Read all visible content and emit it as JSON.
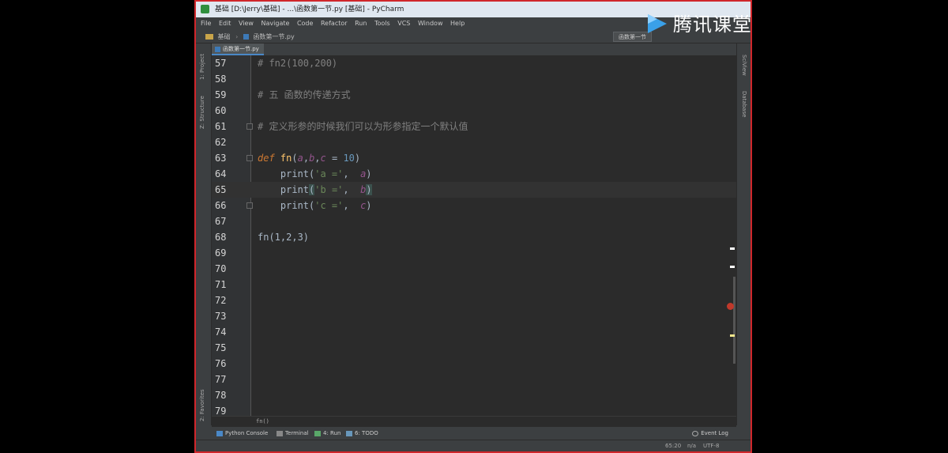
{
  "window": {
    "title": "基础 [D:\\Jerry\\基础] - ...\\函数第一节.py [基础] - PyCharm"
  },
  "menu": [
    "File",
    "Edit",
    "View",
    "Navigate",
    "Code",
    "Refactor",
    "Run",
    "Tools",
    "VCS",
    "Window",
    "Help"
  ],
  "nav": {
    "project": "基础",
    "file": "函数第一节.py",
    "run_config": "函数第一节"
  },
  "tab": {
    "label": "函数第一节.py"
  },
  "left_tools": [
    "1: Project",
    "Z: Structure",
    "2: Favorites"
  ],
  "right_tools": [
    "SciView",
    "Database"
  ],
  "editor": {
    "lines": [
      {
        "n": "57",
        "parts": [
          [
            "comment",
            "# fn2(100,200)"
          ]
        ]
      },
      {
        "n": "58",
        "parts": []
      },
      {
        "n": "59",
        "parts": [
          [
            "comment",
            "# 五 函数的传递方式"
          ]
        ]
      },
      {
        "n": "60",
        "parts": []
      },
      {
        "n": "61",
        "parts": [
          [
            "comment",
            "# 定义形参的时候我们可以为形参指定一个默认值"
          ]
        ]
      },
      {
        "n": "62",
        "parts": []
      },
      {
        "n": "63",
        "parts": [
          [
            "kw",
            "def "
          ],
          [
            "fnname",
            "fn"
          ],
          [
            "p",
            "("
          ],
          [
            "param",
            "a"
          ],
          [
            "p",
            ","
          ],
          [
            "param",
            "b"
          ],
          [
            "p",
            ","
          ],
          [
            "param",
            "c"
          ],
          [
            "p",
            " = "
          ],
          [
            "num",
            "10"
          ],
          [
            "p",
            ")"
          ]
        ]
      },
      {
        "n": "64",
        "parts": [
          [
            "p",
            "    print("
          ],
          [
            "str",
            "'a ='"
          ],
          [
            "p",
            ",  "
          ],
          [
            "param",
            "a"
          ],
          [
            "p",
            ")"
          ]
        ]
      },
      {
        "n": "65",
        "parts": [
          [
            "p",
            "    print"
          ],
          [
            "hl",
            "("
          ],
          [
            "str",
            "'b ='"
          ],
          [
            "p",
            ",  "
          ],
          [
            "param",
            "b"
          ],
          [
            "hl",
            ")"
          ]
        ]
      },
      {
        "n": "66",
        "parts": [
          [
            "p",
            "    print("
          ],
          [
            "str",
            "'c ='"
          ],
          [
            "p",
            ",  "
          ],
          [
            "param",
            "c"
          ],
          [
            "p",
            ")"
          ]
        ]
      },
      {
        "n": "67",
        "parts": []
      },
      {
        "n": "68",
        "parts": [
          [
            "p",
            "fn(1,2,3)"
          ]
        ]
      },
      {
        "n": "69",
        "parts": []
      },
      {
        "n": "70",
        "parts": []
      },
      {
        "n": "71",
        "parts": []
      },
      {
        "n": "72",
        "parts": []
      },
      {
        "n": "73",
        "parts": []
      },
      {
        "n": "74",
        "parts": []
      },
      {
        "n": "75",
        "parts": []
      },
      {
        "n": "76",
        "parts": []
      },
      {
        "n": "77",
        "parts": []
      },
      {
        "n": "78",
        "parts": []
      },
      {
        "n": "79",
        "parts": []
      }
    ],
    "current_line": "65",
    "breadcrumb": "fn()"
  },
  "bottom_tools": [
    {
      "label": "Python Console",
      "icon": "python-console-icon"
    },
    {
      "label": "Terminal",
      "icon": "terminal-icon"
    },
    {
      "label": "4: Run",
      "icon": "run-icon"
    },
    {
      "label": "6: TODO",
      "icon": "todo-icon"
    }
  ],
  "event_log": "Event Log",
  "status": {
    "position": "65:20",
    "na": "n/a",
    "encoding": "UTF-8"
  },
  "watermark": "腾讯课堂",
  "colors": {
    "comment": "#808080",
    "keyword": "#cc7832",
    "string": "#6a8759",
    "number": "#6897bb",
    "param": "#94558d"
  }
}
